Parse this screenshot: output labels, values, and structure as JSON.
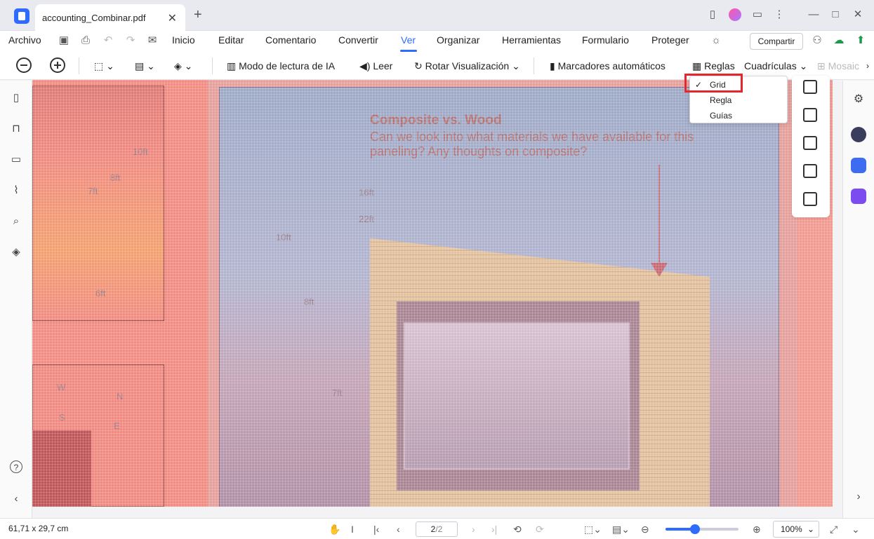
{
  "titlebar": {
    "tab_title": "accounting_Combinar.pdf",
    "close": "✕",
    "new_tab": "+"
  },
  "menu": {
    "archivo": "Archivo",
    "items": [
      "Inicio",
      "Editar",
      "Comentario",
      "Convertir",
      "Ver",
      "Organizar",
      "Herramientas",
      "Formulario",
      "Proteger"
    ],
    "share": "Compartir"
  },
  "toolbar": {
    "ai_reading": "Modo de lectura de IA",
    "read": "Leer",
    "rotate": "Rotar Visualización",
    "auto_bookmarks": "Marcadores automáticos",
    "rulers": "Reglas",
    "grids": "Cuadrículas",
    "mosaic": "Mosaic"
  },
  "dropdown": {
    "items": [
      "Grid",
      "Regla",
      "Guías"
    ],
    "checked": "Grid",
    "check_mark": "✓"
  },
  "document": {
    "headline": "Composite vs. Wood",
    "subline": "Can we look into what materials we have available for this paneling? Any thoughts on composite?",
    "dims_left": [
      "10ft",
      "8ft",
      "7ft",
      "6ft"
    ],
    "compass": [
      "W",
      "N",
      "S",
      "E"
    ],
    "dims_main": [
      "16ft",
      "22ft",
      "10ft",
      "8ft",
      "7ft"
    ]
  },
  "status": {
    "dimensions": "61,71 x 29,7 cm",
    "page_current": "2",
    "page_total": "/2",
    "zoom": "100%",
    "zoom_fraction": 0.4
  },
  "colors": {
    "accent": "#2f6bff",
    "highlight": "#e5272d",
    "overlay": "#f28c82"
  }
}
